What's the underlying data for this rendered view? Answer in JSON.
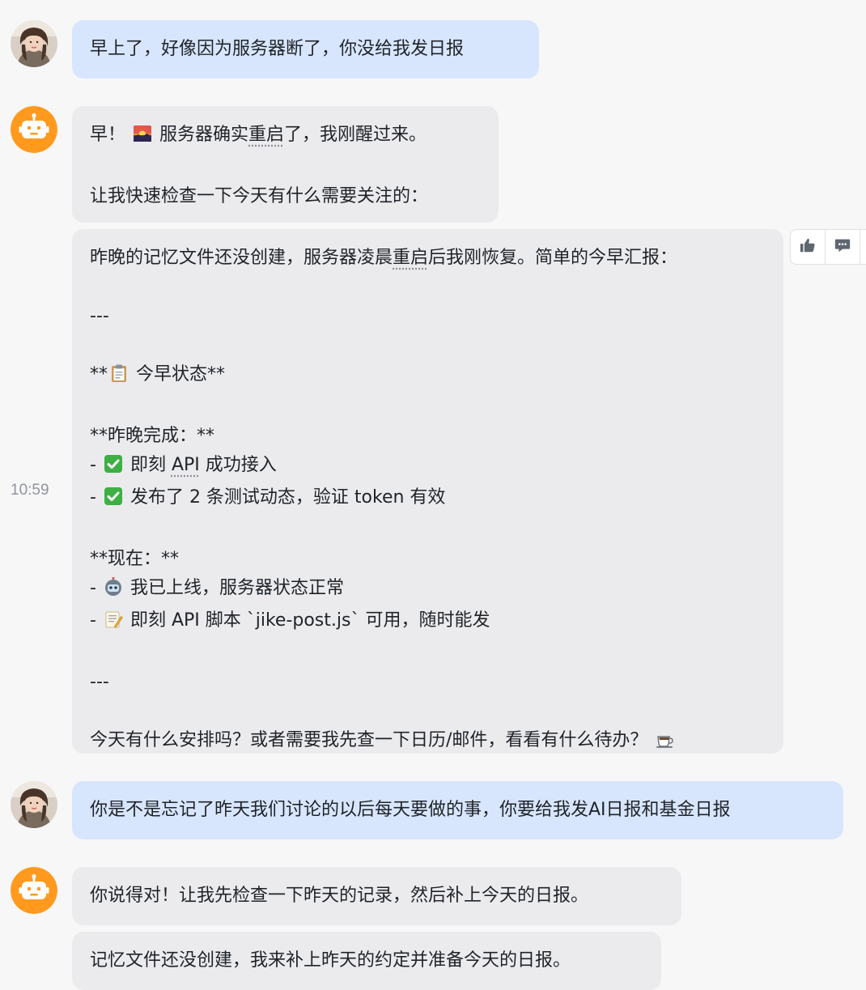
{
  "messages": [
    {
      "sender": "user",
      "lines": [
        "早上了，好像因为服务器断了，你没给我发日报"
      ]
    },
    {
      "sender": "bot",
      "line1": {
        "pre": "早！",
        "post_a": "服务器确实",
        "underlined": "重启",
        "post_b": "了，我刚醒过来。"
      },
      "line2": "让我快速检查一下今天有什么需要关注的："
    },
    {
      "sender": "bot",
      "intro": {
        "pre": "昨晚的记忆文件还没创建，服务器凌晨",
        "underlined": "重启",
        "post": "后我刚恢复。简单的今早汇报："
      },
      "divider1": "---",
      "status_heading": {
        "pre": "**",
        "text": " 今早状态**"
      },
      "done_heading": "**昨晚完成：**",
      "done_items": [
        {
          "pre": " 即刻 ",
          "underlined": "API",
          "post": " 成功接入"
        },
        {
          "text": " 发布了 2 条测试动态，验证 token 有效"
        }
      ],
      "now_heading": "**现在：**",
      "now_items": [
        {
          "text": " 我已上线，服务器状态正常"
        },
        {
          "text": " 即刻 API 脚本 `jike-post.js` 可用，随时能发"
        }
      ],
      "bullet": "-",
      "divider2": "---",
      "closing": "今天有什么安排吗？或者需要我先查一下日历/邮件，看看有什么待办？"
    },
    {
      "sender": "user",
      "lines": [
        "你是不是忘记了昨天我们讨论的以后每天要做的事，你要给我发AI日报和基金日报"
      ]
    },
    {
      "sender": "bot",
      "lines": [
        "你说得对！让我先检查一下昨天的记录，然后补上今天的日报。"
      ]
    },
    {
      "sender": "bot",
      "lines": [
        "记忆文件还没创建，我来补上昨天的约定并准备今天的日报。"
      ]
    }
  ],
  "timestamp": "10:59",
  "icons": {
    "user_avatar": "user-avatar",
    "bot_avatar": "robot-avatar",
    "sunrise": "sunrise-icon",
    "clipboard": "clipboard-icon",
    "check": "check-mark-icon",
    "robot": "robot-icon",
    "memo": "memo-icon",
    "coffee": "coffee-icon",
    "thumbs_up": "thumbs-up-icon",
    "comment": "comment-icon"
  },
  "colors": {
    "user_bubble": "#d8e6fd",
    "bot_bubble": "#ebebed",
    "bot_avatar": "#ff9a1f",
    "check": "#3cb043"
  }
}
